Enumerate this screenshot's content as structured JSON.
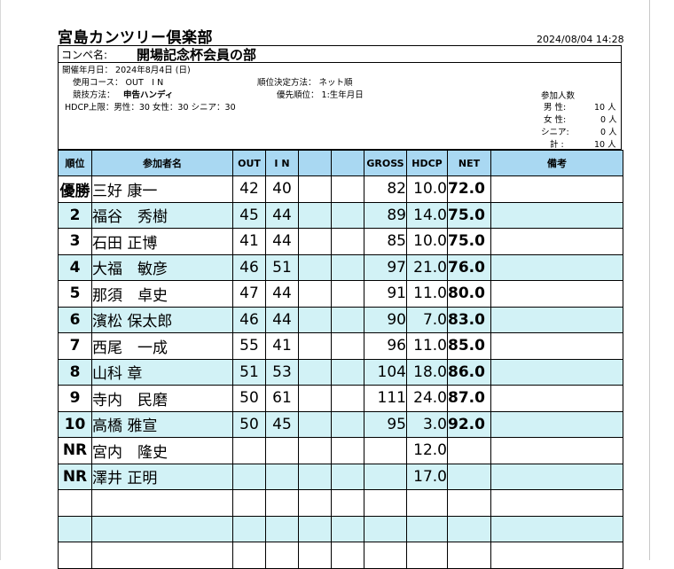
{
  "header": {
    "club_name": "宮島カンツリー倶楽部",
    "print_datetime": "2024/08/04 14:28"
  },
  "info": {
    "comp_label": "コンペ名:",
    "comp_name": "開場記念杯会員の部",
    "date": "開催年月日： 2024年8月4日 (日)",
    "course": "使用コース： OUT　I N",
    "method_label": "競技方法：",
    "method_value": "申告ハンディ",
    "hdcp_limit": "HDCP上限：男性：30 女性：30 シニア：30",
    "rank_method": "順位決定方法： ネット順",
    "priority": "優先順位： 1:生年月日",
    "participants_title": "参加人数",
    "participants": [
      {
        "label": "男 性:",
        "value": "10 人"
      },
      {
        "label": "女 性:",
        "value": "0 人"
      },
      {
        "label": "シニア:",
        "value": "0 人"
      },
      {
        "label": "計 :",
        "value": "10 人"
      }
    ]
  },
  "table": {
    "headers": {
      "rank": "順位",
      "name": "参加者名",
      "out": "OUT",
      "in": "I N",
      "blank1": "",
      "blank2": "",
      "gross": "GROSS",
      "hdcp": "HDCP",
      "net": "NET",
      "note": "備考"
    },
    "rows": [
      {
        "rank": "優勝",
        "name": "三好 康一",
        "out": "42",
        "in": "40",
        "gross": "82",
        "hdcp": "10.0",
        "net": "72.0",
        "note": ""
      },
      {
        "rank": "2",
        "name": "福谷　秀樹",
        "out": "45",
        "in": "44",
        "gross": "89",
        "hdcp": "14.0",
        "net": "75.0",
        "note": ""
      },
      {
        "rank": "3",
        "name": "石田 正博",
        "out": "41",
        "in": "44",
        "gross": "85",
        "hdcp": "10.0",
        "net": "75.0",
        "note": ""
      },
      {
        "rank": "4",
        "name": "大福　敏彦",
        "out": "46",
        "in": "51",
        "gross": "97",
        "hdcp": "21.0",
        "net": "76.0",
        "note": ""
      },
      {
        "rank": "5",
        "name": "那須　卓史",
        "out": "47",
        "in": "44",
        "gross": "91",
        "hdcp": "11.0",
        "net": "80.0",
        "note": ""
      },
      {
        "rank": "6",
        "name": "濱松 保太郎",
        "out": "46",
        "in": "44",
        "gross": "90",
        "hdcp": "7.0",
        "net": "83.0",
        "note": ""
      },
      {
        "rank": "7",
        "name": "西尾　一成",
        "out": "55",
        "in": "41",
        "gross": "96",
        "hdcp": "11.0",
        "net": "85.0",
        "note": ""
      },
      {
        "rank": "8",
        "name": "山科 章",
        "out": "51",
        "in": "53",
        "gross": "104",
        "hdcp": "18.0",
        "net": "86.0",
        "note": ""
      },
      {
        "rank": "9",
        "name": "寺内　民磨",
        "out": "50",
        "in": "61",
        "gross": "111",
        "hdcp": "24.0",
        "net": "87.0",
        "note": ""
      },
      {
        "rank": "10",
        "name": "高橋 雅宣",
        "out": "50",
        "in": "45",
        "gross": "95",
        "hdcp": "3.0",
        "net": "92.0",
        "note": ""
      },
      {
        "rank": "NR",
        "name": "宮内　隆史",
        "out": "",
        "in": "",
        "gross": "",
        "hdcp": "12.0",
        "net": "",
        "note": ""
      },
      {
        "rank": "NR",
        "name": "澤井 正明",
        "out": "",
        "in": "",
        "gross": "",
        "hdcp": "17.0",
        "net": "",
        "note": ""
      },
      {
        "rank": "",
        "name": "",
        "out": "",
        "in": "",
        "gross": "",
        "hdcp": "",
        "net": "",
        "note": ""
      },
      {
        "rank": "",
        "name": "",
        "out": "",
        "in": "",
        "gross": "",
        "hdcp": "",
        "net": "",
        "note": ""
      },
      {
        "rank": "",
        "name": "",
        "out": "",
        "in": "",
        "gross": "",
        "hdcp": "",
        "net": "",
        "note": ""
      }
    ]
  },
  "colors": {
    "header_bg": "#a9d8f2",
    "stripe_bg": "#d2f2f6",
    "row_bg": "#ffffff"
  }
}
